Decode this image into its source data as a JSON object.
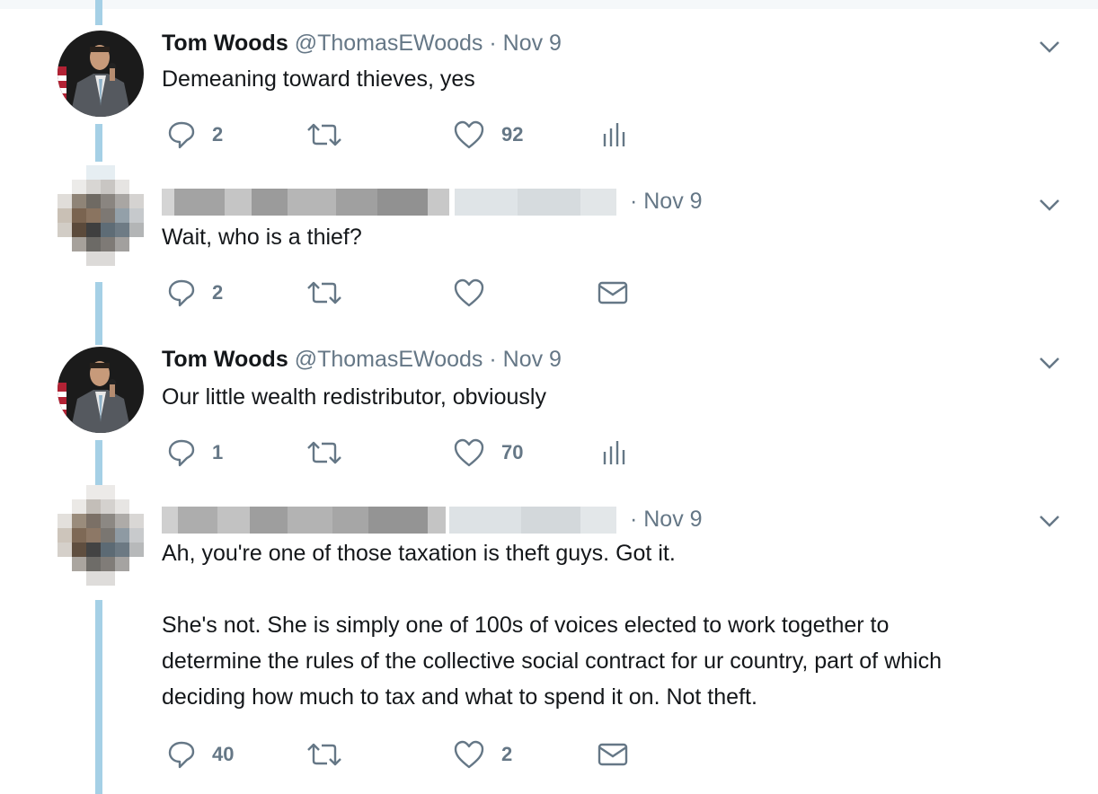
{
  "tweets": [
    {
      "author_name": "Tom Woods",
      "handle": "@ThomasEWoods",
      "separator": "·",
      "date": "Nov 9",
      "text": [
        "Demeaning toward thieves, yes"
      ],
      "replies": "2",
      "retweets": "",
      "likes": "92",
      "extra_action": "analytics-icon",
      "avatar": "photo"
    },
    {
      "author_name": "",
      "handle": "",
      "separator": "·",
      "date": "Nov 9",
      "text": [
        "Wait, who is a thief?"
      ],
      "replies": "2",
      "retweets": "",
      "likes": "",
      "extra_action": "mail-icon",
      "avatar": "pixelated"
    },
    {
      "author_name": "Tom Woods",
      "handle": "@ThomasEWoods",
      "separator": "·",
      "date": "Nov 9",
      "text": [
        "Our little wealth redistributor, obviously"
      ],
      "replies": "1",
      "retweets": "",
      "likes": "70",
      "extra_action": "analytics-icon",
      "avatar": "photo"
    },
    {
      "author_name": "",
      "handle": "",
      "separator": "·",
      "date": "Nov 9",
      "text": [
        "Ah, you're one of those taxation is theft guys.  Got it.",
        "She's not.  She is simply one of 100s of voices elected to work together to",
        "determine the rules of the collective social contract for ur country, part of which",
        "deciding how much to tax and what to spend it on. Not theft."
      ],
      "replies": "40",
      "retweets": "",
      "likes": "2",
      "extra_action": "mail-icon",
      "avatar": "pixelated"
    }
  ],
  "colors": {
    "thread_line": "#a5d0e6",
    "secondary_text": "#657786",
    "primary_text": "#14171a"
  }
}
